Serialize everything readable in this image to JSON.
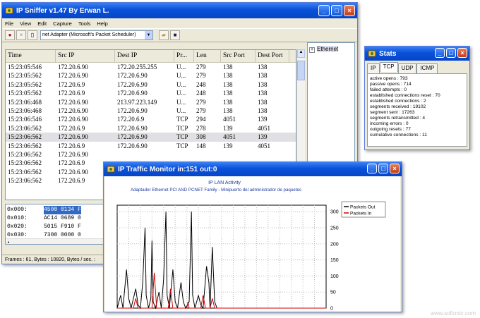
{
  "sniffer": {
    "title": "IP Sniffer v1.47 By Erwan L.",
    "menu": [
      "File",
      "View",
      "Edit",
      "Capture",
      "Tools",
      "Help"
    ],
    "adapter": "net Adapter (Microsoft's Packet Scheduler)",
    "columns": [
      "Time",
      "Src IP",
      "Dest IP",
      "Pr...",
      "Len",
      "Src Port",
      "Dest Port"
    ],
    "rows": [
      [
        "15:23:05:546",
        "172.20.6.90",
        "172.20.255.255",
        "U...",
        "279",
        "138",
        "138"
      ],
      [
        "15:23:05:562",
        "172.20.6.90",
        "172.20.6.90",
        "U...",
        "279",
        "138",
        "138"
      ],
      [
        "15:23:05:562",
        "172.20.6.9",
        "172.20.6.90",
        "U...",
        "248",
        "138",
        "138"
      ],
      [
        "15:23:05:562",
        "172.20.6.9",
        "172.20.6.90",
        "U...",
        "248",
        "138",
        "138"
      ],
      [
        "15:23:06:468",
        "172.20.6.90",
        "213.97.223.149",
        "U...",
        "279",
        "138",
        "138"
      ],
      [
        "15:23:06:468",
        "172.20.6.90",
        "172.20.6.90",
        "U...",
        "279",
        "138",
        "138"
      ],
      [
        "15:23:06:546",
        "172.20.6.90",
        "172.20.6.9",
        "TCP",
        "294",
        "4051",
        "139"
      ],
      [
        "15:23:06:562",
        "172.20.6.9",
        "172.20.6.90",
        "TCP",
        "278",
        "139",
        "4051"
      ],
      [
        "15:23:06:562",
        "172.20.6.90",
        "172.20.6.90",
        "TCP",
        "308",
        "4051",
        "139"
      ],
      [
        "15:23:06:562",
        "172.20.6.9",
        "172.20.6.90",
        "TCP",
        "148",
        "139",
        "4051"
      ],
      [
        "15:23:06:562",
        "172.20.6.90",
        "",
        "",
        "",
        "",
        ""
      ],
      [
        "15:23:06:562",
        "172.20.6.9",
        "",
        "",
        "",
        "",
        ""
      ],
      [
        "15:23:06:562",
        "172.20.6.90",
        "",
        "",
        "",
        "",
        ""
      ],
      [
        "15:23:06:562",
        "172.20.6.9",
        "",
        "",
        "",
        "",
        ""
      ]
    ],
    "hex_rows": [
      {
        "addr": "0x000:",
        "bytes": "4500 0134 F",
        "selected": true
      },
      {
        "addr": "0x010:",
        "bytes": "AC14 0689 0",
        "selected": false
      },
      {
        "addr": "0x020:",
        "bytes": "5015 F910 F",
        "selected": false
      },
      {
        "addr": "0x030:",
        "bytes": "7300 0000 0",
        "selected": false
      }
    ],
    "status": "Frames : 61, Bytes : 10820, Bytes / sec. :",
    "tree_item": "Ethernet"
  },
  "stats": {
    "title": "Stats",
    "tabs": [
      "IP",
      "TCP",
      "UDP",
      "ICMP"
    ],
    "active_tab": "TCP",
    "lines": [
      "active opens : 793",
      "passive opens : 714",
      "failed attempts : 0",
      "established connections reset : 70",
      "established connections : 2",
      "segments received : 19102",
      "segment sent : 17263",
      "segments retransmitted : 4",
      "incoming errors : 0",
      "outgoing resets : 77",
      "cumulative connections : 11"
    ]
  },
  "traffic": {
    "title": "IP Traffic Monitor in:151 out:0"
  },
  "chart_data": {
    "type": "line",
    "title": "IP LAN Activity",
    "subtitle": "Adaptador Ethernet PCI AND PCNET Family - Minipuerto del administrador de paquetes",
    "x": [
      0,
      10,
      20,
      30,
      40,
      50,
      60,
      70,
      80,
      90,
      100,
      110,
      120,
      130,
      140,
      150,
      160,
      170,
      180
    ],
    "xlim": [
      0,
      180
    ],
    "ylim": [
      0,
      320
    ],
    "yticks": [
      0,
      50,
      100,
      150,
      200,
      250,
      300
    ],
    "legend_position": "top-right",
    "grid": true,
    "series": [
      {
        "name": "Packets Out",
        "color": "#000000",
        "points": [
          [
            0,
            0
          ],
          [
            3,
            40
          ],
          [
            5,
            0
          ],
          [
            8,
            120
          ],
          [
            10,
            30
          ],
          [
            12,
            0
          ],
          [
            16,
            60
          ],
          [
            18,
            10
          ],
          [
            20,
            0
          ],
          [
            22,
            80
          ],
          [
            24,
            250
          ],
          [
            25,
            40
          ],
          [
            27,
            0
          ],
          [
            29,
            30
          ],
          [
            30,
            210
          ],
          [
            31,
            20
          ],
          [
            33,
            0
          ],
          [
            36,
            50
          ],
          [
            38,
            0
          ],
          [
            40,
            90
          ],
          [
            42,
            300
          ],
          [
            43,
            40
          ],
          [
            45,
            0
          ],
          [
            48,
            120
          ],
          [
            50,
            20
          ],
          [
            52,
            0
          ],
          [
            55,
            80
          ],
          [
            57,
            20
          ],
          [
            59,
            0
          ],
          [
            62,
            20
          ],
          [
            64,
            300
          ],
          [
            65,
            40
          ],
          [
            67,
            0
          ],
          [
            70,
            40
          ],
          [
            72,
            10
          ],
          [
            74,
            0
          ],
          [
            77,
            130
          ],
          [
            79,
            80
          ],
          [
            80,
            0
          ],
          [
            82,
            190
          ],
          [
            84,
            20
          ],
          [
            86,
            0
          ],
          [
            180,
            0
          ]
        ]
      },
      {
        "name": "Packets In",
        "color": "#d40000",
        "points": [
          [
            0,
            0
          ],
          [
            14,
            0
          ],
          [
            16,
            30
          ],
          [
            18,
            0
          ],
          [
            30,
            0
          ],
          [
            32,
            110
          ],
          [
            34,
            0
          ],
          [
            44,
            0
          ],
          [
            46,
            60
          ],
          [
            48,
            0
          ],
          [
            60,
            0
          ],
          [
            61,
            20
          ],
          [
            62,
            0
          ],
          [
            72,
            0
          ],
          [
            74,
            40
          ],
          [
            76,
            0
          ],
          [
            80,
            0
          ],
          [
            82,
            30
          ],
          [
            84,
            0
          ],
          [
            180,
            0
          ]
        ]
      }
    ]
  }
}
